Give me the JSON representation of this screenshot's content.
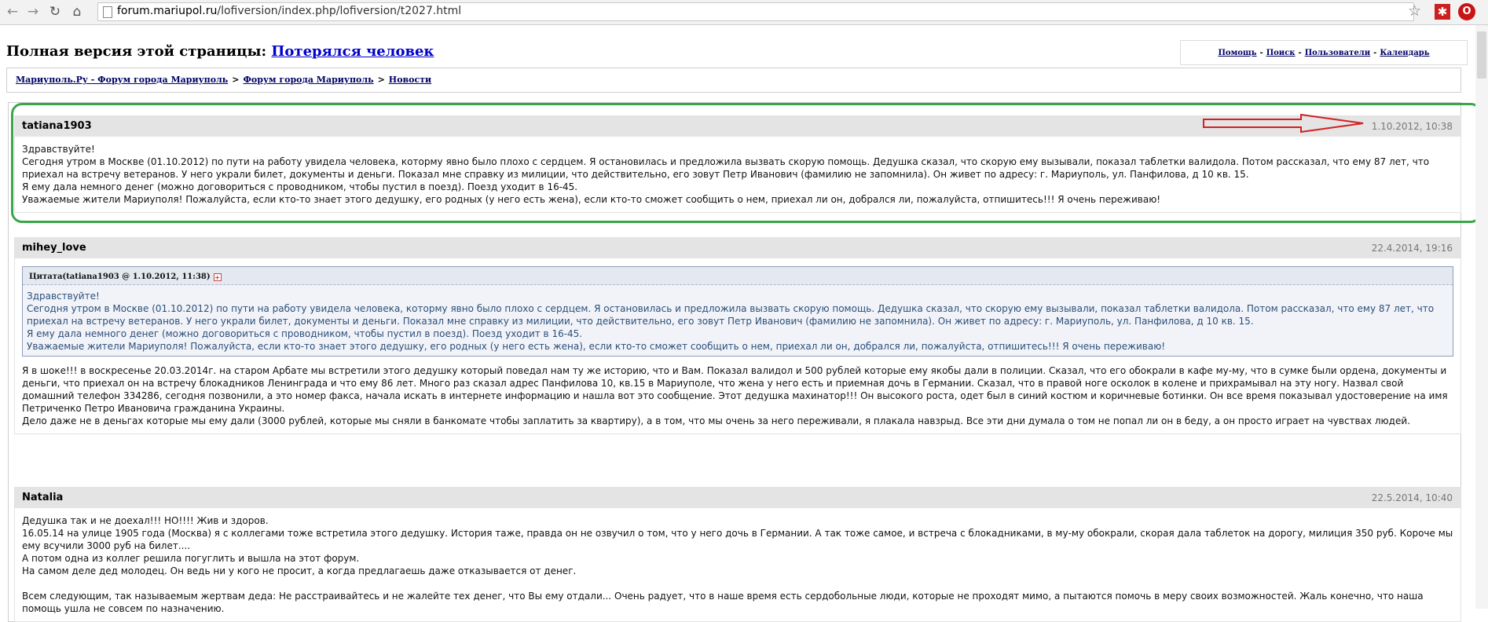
{
  "browser": {
    "url_host": "forum.mariupol.ru",
    "url_path": "/lofiversion/index.php/lofiversion/t2027.html"
  },
  "header": {
    "prefix": "Полная версия этой страницы:",
    "topic_link": "Потерялся человек"
  },
  "toplinks": [
    "Помощь",
    "Поиск",
    "Пользователи",
    "Календарь"
  ],
  "breadcrumb": [
    "Мариуполь.Ру - Форум города Мариуполь",
    "Форум города Мариуполь",
    "Новости"
  ],
  "posts": [
    {
      "author": "tatiana1903",
      "date": "1.10.2012, 10:38",
      "body": [
        "Здравствуйте!",
        "Сегодня утром в Москве (01.10.2012) по пути на работу увидела человека, которму явно было плохо с сердцем. Я остановилась и предложила вызвать скорую помощь. Дедушка сказал, что скорую ему вызывали, показал таблетки валидола. Потом рассказал, что ему 87 лет, что приехал на встречу ветеранов. У него украли билет, документы и деньги. Показал мне справку из милиции, что действительно, его зовут Петр Иванович (фамилию не запомнила). Он живет по адресу: г. Мариуполь, ул. Панфилова, д 10 кв. 15.",
        "Я ему дала немного денег (можно договориться с проводником, чтобы пустил в поезд). Поезд уходит в 16-45.",
        "Уважаемые жители Мариуполя! Пожалуйста, если кто-то знает этого дедушку, его родных (у него есть жена), если кто-то сможет сообщить о нем, приехал ли он, добрался ли, пожалуйста, отпишитесь!!! Я очень переживаю!"
      ]
    },
    {
      "author": "mihey_love",
      "date": "22.4.2014, 19:16",
      "quote_title": "Цитата(tatiana1903 @ 1.10.2012, 11:38)",
      "quote": [
        "Здравствуйте!",
        "Сегодня утром в Москве (01.10.2012) по пути на работу увидела человека, которму явно было плохо с сердцем. Я остановилась и предложила вызвать скорую помощь. Дедушка сказал, что скорую ему вызывали, показал таблетки валидола. Потом рассказал, что ему 87 лет, что приехал на встречу ветеранов. У него украли билет, документы и деньги. Показал мне справку из милиции, что действительно, его зовут Петр Иванович (фамилию не запомнила). Он живет по адресу: г. Мариуполь, ул. Панфилова, д 10 кв. 15.",
        "Я ему дала немного денег (можно договориться с проводником, чтобы пустил в поезд). Поезд уходит в 16-45.",
        "Уважаемые жители Мариуполя! Пожалуйста, если кто-то знает этого дедушку, его родных (у него есть жена), если кто-то сможет сообщить о нем, приехал ли он, добрался ли, пожалуйста, отпишитесь!!! Я очень переживаю!"
      ],
      "body": [
        "Я в шоке!!! в воскресенье 20.03.2014г. на старом Арбате мы встретили этого дедушку который поведал нам ту же историю, что и Вам. Показал валидол и 500 рублей которые ему якобы дали в полиции. Сказал, что его обокрали в кафе му-му, что в сумке были ордена, документы и деньги, что приехал он на встречу блокадников Ленинграда и что ему 86 лет. Много раз сказал адрес Панфилова 10, кв.15 в Мариуполе, что жена у него есть и приемная дочь в Германии. Сказал, что в правой ноге осколок в колене и прихрамывал на эту ногу. Назвал свой домашний телефон 334286, сегодня позвонили, а это номер факса, начала искать в интернете информацию и нашла вот это сообщение. Этот дедушка махинатор!!! Он высокого роста, одет был в синий костюм и коричневые ботинки. Он все время показывал удостоверение на имя Петриченко Петро Ивановича гражданина Украины.",
        "Дело даже не в деньгах которые мы ему дали (3000 рублей, которые мы сняли в банкомате чтобы заплатить за квартиру), а в том, что мы очень за него переживали, я плакала навзрыд. Все эти дни думала о том не попал ли он в беду, а он просто играет на чувствах людей."
      ]
    },
    {
      "author": "Natalia",
      "date": "22.5.2014, 10:40",
      "body": [
        "Дедушка так и не доехал!!! НО!!!! Жив и здоров.",
        "16.05.14 на улице 1905 года (Москва) я с коллегами тоже встретила этого дедушку. История таже, правда он не озвучил о том, что у него дочь в Германии. А так тоже самое, и встреча с блокадниками, в му-му обокрали, скорая дала таблеток на дорогу, милиция 350 руб. Короче мы ему всучили 3000 руб на билет....",
        "А потом одна из коллег решила погуглить и вышла на этот форум.",
        "На самом деле дед молодец. Он ведь ни у кого не просит, а когда предлагаешь даже отказывается от денег.",
        "",
        "Всем следующим, так называемым жертвам деда: Не расстраивайтесь и не жалейте тех денег, что Вы ему отдали... Очень радует, что в наше время есть сердобольные люди, которые не проходят мимо, а пытаются помочь в меру своих возможностей. Жаль конечно, что наша помощь ушла не совсем по назначению."
      ]
    }
  ],
  "colors": {
    "annotation_box": "#3aa64a",
    "annotation_arrow": "#d42020"
  }
}
